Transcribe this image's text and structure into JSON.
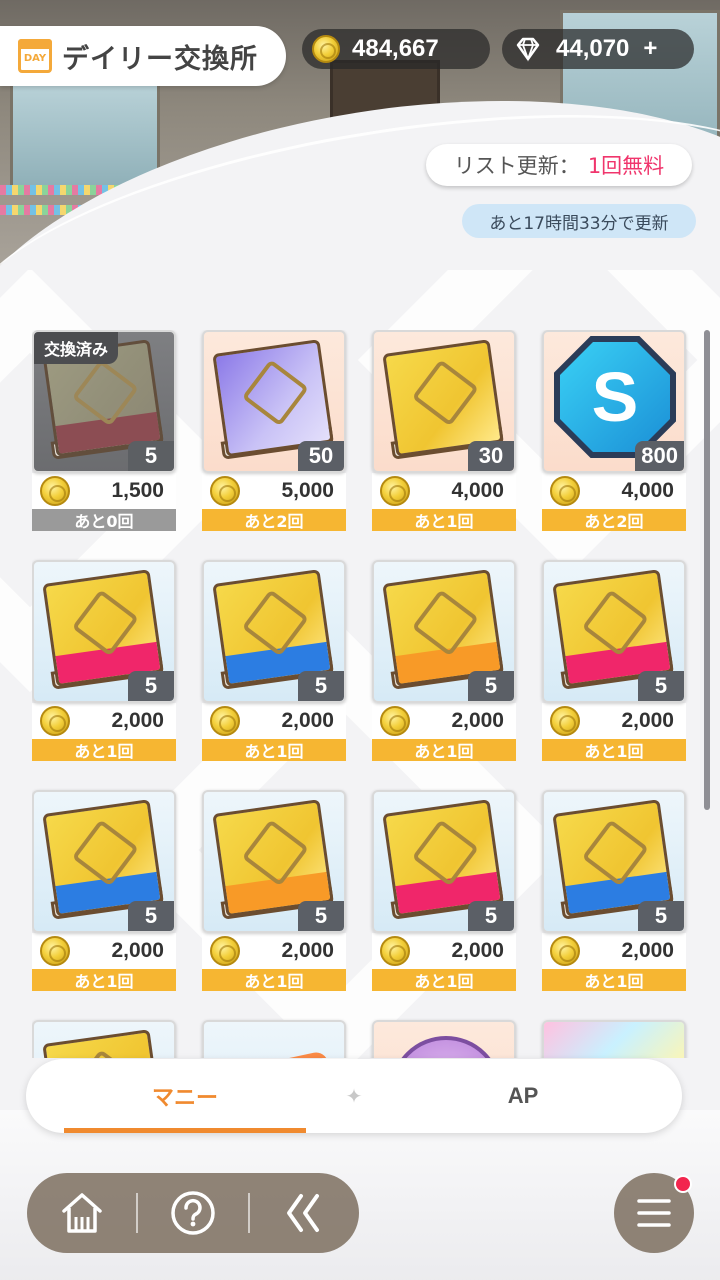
{
  "header": {
    "day_badge": "DAY",
    "title": "デイリー交換所",
    "money": "484,667",
    "gems": "44,070",
    "gems_plus": "+",
    "refresh_label": "リスト更新：",
    "refresh_free": "1回無料",
    "timer": "あと17時間33分で更新"
  },
  "items": [
    {
      "kind": "book",
      "color": "red",
      "cover": "grey-book",
      "qty": "5",
      "price": "1,500",
      "remain": "あと0回",
      "done": true,
      "done_label": "交換済み",
      "bg": "bg-grey"
    },
    {
      "kind": "book",
      "color": "none",
      "cover": "purple",
      "qty": "50",
      "price": "5,000",
      "remain": "あと2回",
      "done": false,
      "bg": "bg-peach"
    },
    {
      "kind": "book",
      "color": "none",
      "cover": "yellow",
      "qty": "30",
      "price": "4,000",
      "remain": "あと1回",
      "done": false,
      "bg": "bg-peach"
    },
    {
      "kind": "s",
      "qty": "800",
      "price": "4,000",
      "remain": "あと2回",
      "done": false,
      "bg": "bg-peach",
      "s_letter": "S"
    },
    {
      "kind": "book",
      "color": "red",
      "cover": "yellow",
      "qty": "5",
      "price": "2,000",
      "remain": "あと1回",
      "done": false,
      "bg": "bg-blue"
    },
    {
      "kind": "book",
      "color": "blue",
      "cover": "yellow",
      "qty": "5",
      "price": "2,000",
      "remain": "あと1回",
      "done": false,
      "bg": "bg-blue"
    },
    {
      "kind": "book",
      "color": "orange",
      "cover": "yellow",
      "qty": "5",
      "price": "2,000",
      "remain": "あと1回",
      "done": false,
      "bg": "bg-blue"
    },
    {
      "kind": "book",
      "color": "red",
      "cover": "yellow",
      "qty": "5",
      "price": "2,000",
      "remain": "あと1回",
      "done": false,
      "bg": "bg-blue"
    },
    {
      "kind": "book",
      "color": "blue",
      "cover": "yellow",
      "qty": "5",
      "price": "2,000",
      "remain": "あと1回",
      "done": false,
      "bg": "bg-blue"
    },
    {
      "kind": "book",
      "color": "orange",
      "cover": "yellow",
      "qty": "5",
      "price": "2,000",
      "remain": "あと1回",
      "done": false,
      "bg": "bg-blue"
    },
    {
      "kind": "book",
      "color": "red",
      "cover": "yellow",
      "qty": "5",
      "price": "2,000",
      "remain": "あと1回",
      "done": false,
      "bg": "bg-blue"
    },
    {
      "kind": "book",
      "color": "blue",
      "cover": "yellow",
      "qty": "5",
      "price": "2,000",
      "remain": "あと1回",
      "done": false,
      "bg": "bg-blue"
    },
    {
      "kind": "book",
      "color": "none",
      "cover": "yellow",
      "qty": "",
      "price": "",
      "remain": "",
      "done": false,
      "bg": "bg-blue"
    },
    {
      "kind": "orange",
      "qty": "",
      "price": "",
      "remain": "",
      "done": false,
      "bg": "bg-blue"
    },
    {
      "kind": "round",
      "qty": "",
      "price": "",
      "remain": "",
      "done": false,
      "bg": "bg-peach"
    },
    {
      "kind": "rainbow",
      "qty": "",
      "price": "",
      "remain": "",
      "done": false,
      "bg": "bg-peach"
    }
  ],
  "tabs": [
    {
      "label": "マニー",
      "active": true
    },
    {
      "label": "AP",
      "active": false
    }
  ],
  "tab_separator": "✦",
  "nav": {
    "home_icon": "home-icon",
    "help_icon": "help-icon",
    "back_icon": "back-icon",
    "menu_icon": "menu-icon"
  },
  "colors": {
    "accent": "#f08a2f",
    "remain_bar": "#f6b632",
    "free_text": "#f0356c",
    "notification": "#f2264e"
  }
}
